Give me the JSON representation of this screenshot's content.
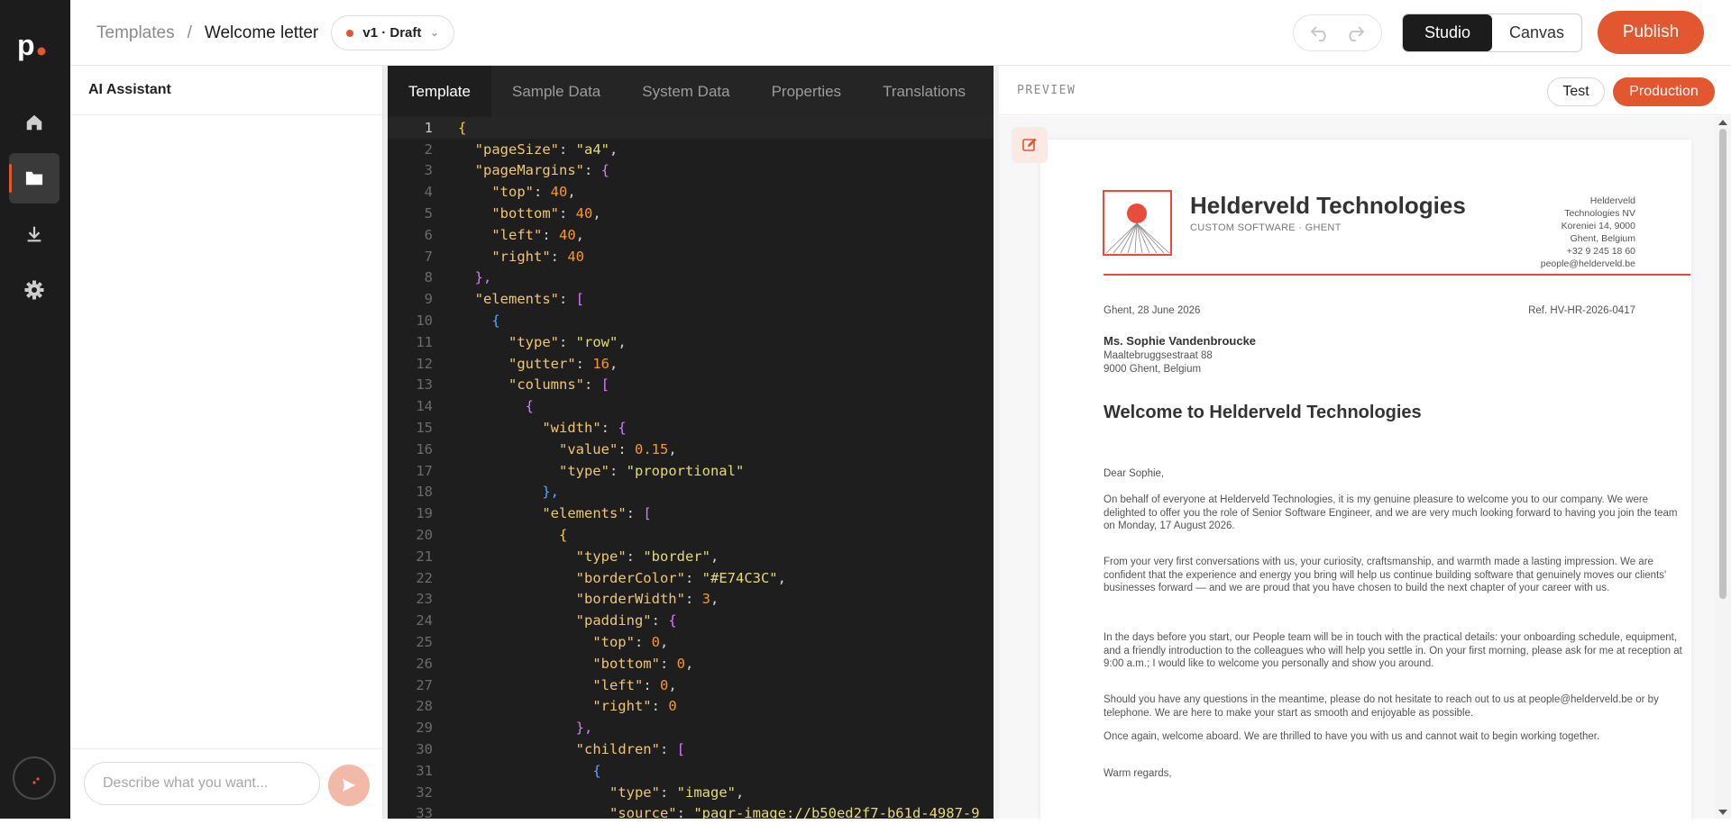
{
  "app": {
    "logo_text": "p."
  },
  "rail": {
    "items": [
      {
        "icon": "home-icon",
        "active": false
      },
      {
        "icon": "folder-icon",
        "active": true
      },
      {
        "icon": "download-icon",
        "active": false
      },
      {
        "icon": "gear-icon",
        "active": false
      }
    ]
  },
  "topbar": {
    "breadcrumb_root": "Templates",
    "breadcrumb_sep": "/",
    "breadcrumb_current": "Welcome letter",
    "version_label": "v1 · Draft",
    "mode_studio": "Studio",
    "mode_canvas": "Canvas",
    "publish_label": "Publish"
  },
  "ai_panel": {
    "title": "AI Assistant",
    "input_placeholder": "Describe what you want..."
  },
  "editor": {
    "tabs": [
      "Template",
      "Sample Data",
      "System Data",
      "Properties",
      "Translations"
    ],
    "active_tab": "Template",
    "lines": [
      "{",
      "  \"pageSize\": \"a4\",",
      "  \"pageMargins\": {",
      "    \"top\": 40,",
      "    \"bottom\": 40,",
      "    \"left\": 40,",
      "    \"right\": 40",
      "  },",
      "  \"elements\": [",
      "    {",
      "      \"type\": \"row\",",
      "      \"gutter\": 16,",
      "      \"columns\": [",
      "        {",
      "          \"width\": {",
      "            \"value\": 0.15,",
      "            \"type\": \"proportional\"",
      "          },",
      "          \"elements\": [",
      "            {",
      "              \"type\": \"border\",",
      "              \"borderColor\": \"#E74C3C\",",
      "              \"borderWidth\": 3,",
      "              \"padding\": {",
      "                \"top\": 0,",
      "                \"bottom\": 0,",
      "                \"left\": 0,",
      "                \"right\": 0",
      "              },",
      "              \"children\": [",
      "                {",
      "                  \"type\": \"image\",",
      "                  \"source\": \"pagr-image://b50ed2f7-b61d-4987-9"
    ]
  },
  "preview": {
    "label": "PREVIEW",
    "test_label": "Test",
    "production_label": "Production",
    "letter": {
      "company_name": "Helderveld Technologies",
      "company_tagline": "CUSTOM SOFTWARE · GHENT",
      "address_lines": [
        "Helderveld",
        "Technologies NV",
        "Koreniei 14, 9000",
        "Ghent, Belgium",
        "+32 9 245 18 60",
        "people@helderveld.be"
      ],
      "date": "Ghent, 28 June 2026",
      "reference": "Ref. HV-HR-2026-0417",
      "recipient_name": "Ms. Sophie Vandenbroucke",
      "recipient_street": "Maaltebruggsestraat 88",
      "recipient_city": "9000 Ghent, Belgium",
      "heading": "Welcome to Helderveld Technologies",
      "salutation": "Dear Sophie,",
      "paragraphs": [
        "On behalf of everyone at Helderveld Technologies, it is my genuine pleasure to welcome you to our company. We were delighted to offer you the role of Senior Software Engineer, and we are very much looking forward to having you join the team on Monday, 17 August 2026.",
        "From your very first conversations with us, your curiosity, craftsmanship, and warmth made a lasting impression. We are confident that the experience and energy you bring will help us continue building software that genuinely moves our clients' businesses forward — and we are proud that you have chosen to build the next chapter of your career with us.",
        "In the days before you start, our People team will be in touch with the practical details: your onboarding schedule, equipment, and a friendly introduction to the colleagues who will help you settle in. On your first morning, please ask for me at reception at 9:00 a.m.; I would like to welcome you personally and show you around.",
        "Should you have any questions in the meantime, please do not hesitate to reach out to us at people@helderveld.be or by telephone. We are here to make your start as smooth and enjoyable as possible.",
        "Once again, welcome aboard. We are thrilled to have you with us and cannot wait to begin working together."
      ],
      "closing": "Warm regards,"
    }
  }
}
